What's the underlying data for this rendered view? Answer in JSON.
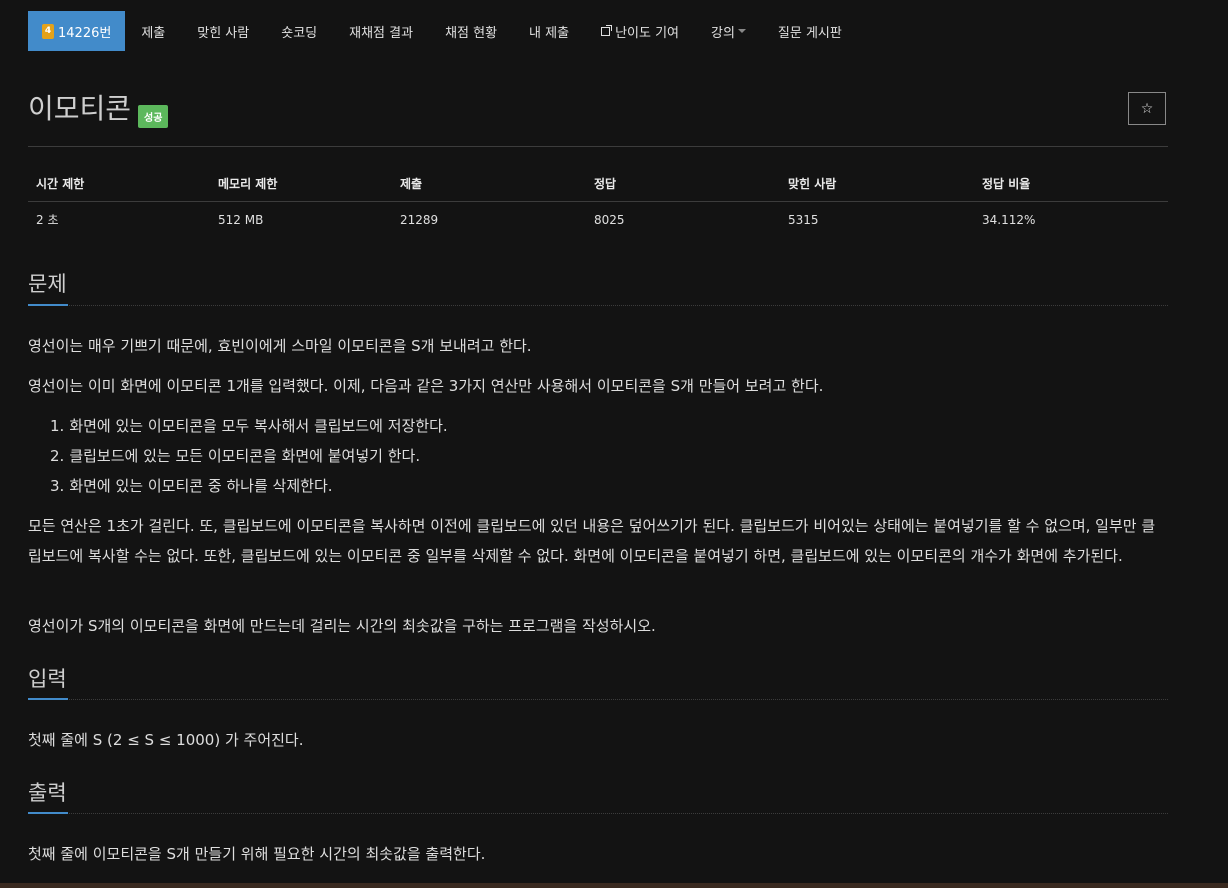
{
  "nav": {
    "problem_id": "14226번",
    "tier": "4",
    "items": [
      "제출",
      "맞힌 사람",
      "숏코딩",
      "재채점 결과",
      "채점 현황",
      "내 제출",
      "난이도 기여",
      "강의",
      "질문 게시판"
    ]
  },
  "problem": {
    "title": "이모티콘",
    "status_badge": "성공",
    "star": "☆"
  },
  "stats": {
    "headers": [
      "시간 제한",
      "메모리 제한",
      "제출",
      "정답",
      "맞힌 사람",
      "정답 비율"
    ],
    "values": [
      "2 초",
      "512 MB",
      "21289",
      "8025",
      "5315",
      "34.112%"
    ]
  },
  "sections": {
    "description": {
      "heading": "문제",
      "p1": "영선이는 매우 기쁘기 때문에, 효빈이에게 스마일 이모티콘을 S개 보내려고 한다.",
      "p2": "영선이는 이미 화면에 이모티콘 1개를 입력했다. 이제, 다음과 같은 3가지 연산만 사용해서 이모티콘을 S개 만들어 보려고 한다.",
      "list": [
        "화면에 있는 이모티콘을 모두 복사해서 클립보드에 저장한다.",
        "클립보드에 있는 모든 이모티콘을 화면에 붙여넣기 한다.",
        "화면에 있는 이모티콘 중 하나를 삭제한다."
      ],
      "p3": "모든 연산은 1초가 걸린다. 또, 클립보드에 이모티콘을 복사하면 이전에 클립보드에 있던 내용은 덮어쓰기가 된다. 클립보드가 비어있는 상태에는 붙여넣기를 할 수 없으며, 일부만 클립보드에 복사할 수는 없다. 또한, 클립보드에 있는 이모티콘 중 일부를 삭제할 수 없다. 화면에 이모티콘을 붙여넣기 하면, 클립보드에 있는 이모티콘의 개수가 화면에 추가된다.",
      "p4": "영선이가 S개의 이모티콘을 화면에 만드는데 걸리는 시간의 최솟값을 구하는 프로그램을 작성하시오."
    },
    "input": {
      "heading": "입력",
      "text": "첫째 줄에 S (2 ≤ S ≤ 1000) 가 주어진다."
    },
    "output": {
      "heading": "출력",
      "text": "첫째 줄에 이모티콘을 S개 만들기 위해 필요한 시간의 최솟값을 출력한다."
    }
  }
}
